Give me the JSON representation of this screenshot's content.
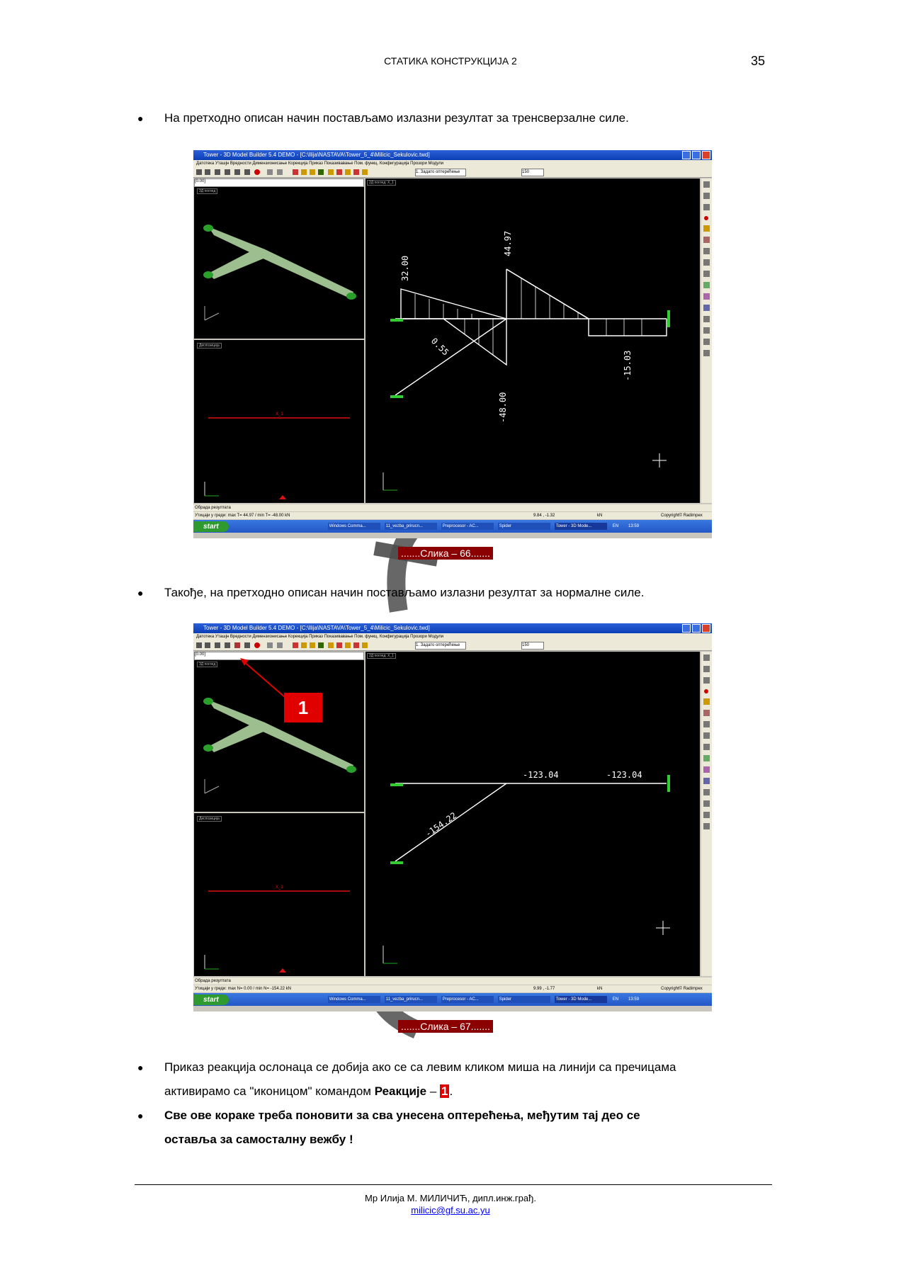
{
  "header": {
    "title": "СТАТИКА КОНСТРУКЦИЈА 2",
    "page_number": "35"
  },
  "bullets": {
    "b1": "На претходно описан начин постављамо излазни резултат за тренсверзалне силе.",
    "b2": "Такође, на претходно описан начин постављамо излазни резултат за нормалне силе.",
    "b3_line1": "Приказ реакција ослонаца се добија ако се са левим кликом миша на линији са пречицама",
    "b3_line2_pre": "активирамо са \"иконицом\" командом ",
    "b3_line2_bold": "Реакције",
    "b3_line2_dash": " – ",
    "b3_line2_marker": "1",
    "b3_line2_end": ".",
    "b4_line1": "Све ове кораке треба поновити за сва унесена оптерећења, међутим тај део се",
    "b4_line2": "оставља за самосталну вежбу !"
  },
  "figure1": {
    "caption": ".......Слика – 66.......",
    "title_bar": "Tower - 3D Model Builder 5.4 DEMO - [C:\\Ilija\\NASTAVA\\Tower_5_4\\Milicic_Sekulovic.twd]",
    "menu": "Датотека   Уташјн   Вредности   Димензионисање   Корекција   Приказ   Показивавање   Пом. функц.   Конфигурација   Прозори   Модули",
    "combo_load": "1. Задато оптерећење",
    "combo_zoom": "150",
    "pane_top_label": "3Д поглед",
    "pane_bottom_label": "Диспозиција",
    "pane_right_label": "2Д поглед: X_1",
    "top_field": "[0.00]",
    "values": [
      "32.00",
      "44.97",
      "0.55",
      "-48.00",
      "-15.03"
    ],
    "status_left": "Обрада резултата",
    "status_line": "Утицаји у греди: max T= 44.97 / min T= -48.00 kN",
    "status_coords": "9.84 , -1.32",
    "status_unit": "kN",
    "status_copy": "Copyright© Radimpex",
    "start": "start",
    "task1": "Windows Comma...",
    "task2": "11_vezba_prirucn...",
    "task3": "Preprocesor - AC...",
    "task4": "Spider",
    "task5": "Tower - 3D Mode...",
    "lang": "EN",
    "clock": "13:59",
    "axis_x": "X_1"
  },
  "figure2": {
    "caption": ".......Слика – 67.......",
    "title_bar": "Tower - 3D Model Builder 5.4 DEMO - [C:\\Ilija\\NASTAVA\\Tower_5_4\\Milicic_Sekulovic.twd]",
    "menu": "Датотека   Уташјн   Вредности   Димензионисање   Корекција   Приказ   Показивавање   Пом. функц.   Конфигурација   Прозори   Модули",
    "combo_load": "1. Задато оптерећење",
    "combo_zoom": "150",
    "pane_top_label": "3Д поглед",
    "pane_bottom_label": "Диспозиција",
    "pane_right_label": "2Д поглед: X_1",
    "top_field": "[0.00]",
    "values": [
      "-123.04",
      "-123.04",
      "-154.22"
    ],
    "marker": "1",
    "status_left": "Обрада резултата",
    "status_line": "Утицаји у греди: max N= 0.00 / min N= -154.22 kN",
    "status_coords": "9.99 , -1.77",
    "status_unit": "kN",
    "status_copy": "Copyright© Radimpex",
    "start": "start",
    "task1": "Windows Comma...",
    "task2": "11_vezba_prirucn...",
    "task3": "Preprocesor - AC...",
    "task4": "Spider",
    "task5": "Tower - 3D Mode...",
    "lang": "EN",
    "clock": "13:59",
    "axis_x": "X_1"
  },
  "footer": {
    "author": "Мр Илија М. МИЛИЧИЋ, дипл.инж.грађ.",
    "email": "milicic@gf.su.ac.yu"
  },
  "colors": {
    "caption_bg": "#8b0000",
    "beam_green": "#9dbf8f",
    "marker_red": "#e00000",
    "link": "#0000ff"
  }
}
